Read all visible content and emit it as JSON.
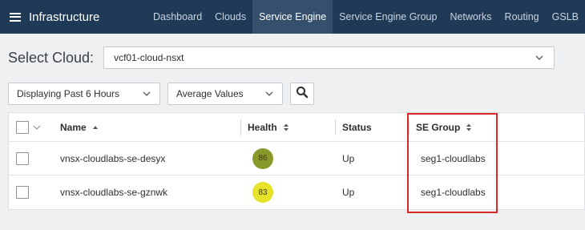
{
  "app": {
    "title": "Infrastructure"
  },
  "nav": {
    "tabs": [
      {
        "label": "Dashboard",
        "active": false
      },
      {
        "label": "Clouds",
        "active": false
      },
      {
        "label": "Service Engine",
        "active": true
      },
      {
        "label": "Service Engine Group",
        "active": false
      },
      {
        "label": "Networks",
        "active": false
      },
      {
        "label": "Routing",
        "active": false
      },
      {
        "label": "GSLB",
        "active": false
      }
    ]
  },
  "cloud": {
    "label": "Select Cloud:",
    "value": "vcf01-cloud-nsxt"
  },
  "filters": {
    "time_range": "Displaying Past 6 Hours",
    "values_mode": "Average Values"
  },
  "table": {
    "columns": {
      "name": "Name",
      "health": "Health",
      "status": "Status",
      "group": "SE Group"
    },
    "rows": [
      {
        "name": "vnsx-cloudlabs-se-desyx",
        "health": "86",
        "health_color": "#8a9a2a",
        "status": "Up",
        "group": "seg1-cloudlabs"
      },
      {
        "name": "vnsx-cloudlabs-se-gznwk",
        "health": "83",
        "health_color": "#e6e22a",
        "status": "Up",
        "group": "seg1-cloudlabs"
      }
    ]
  },
  "colors": {
    "nav_bg": "#1f3a57",
    "nav_active": "#34506d",
    "highlight": "#d62828"
  }
}
